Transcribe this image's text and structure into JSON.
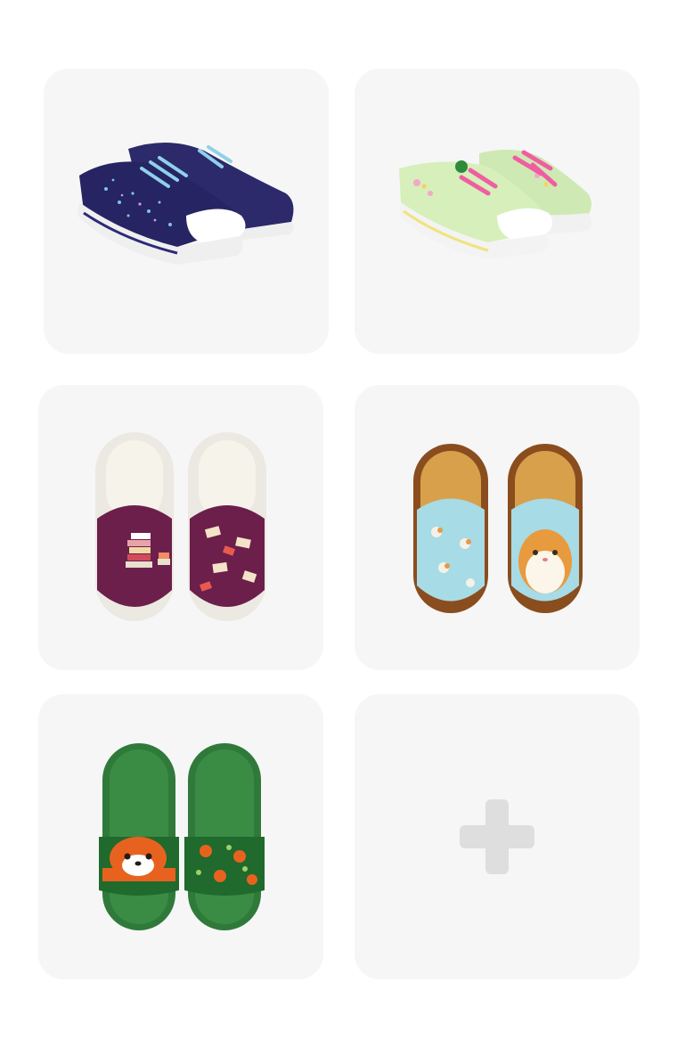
{
  "grid": {
    "items": [
      {
        "kind": "product",
        "icon": "sneakers-galaxy-image"
      },
      {
        "kind": "product",
        "icon": "sneakers-floral-image"
      },
      {
        "kind": "product",
        "icon": "slippers-books-image"
      },
      {
        "kind": "product",
        "icon": "slippers-hamster-image"
      },
      {
        "kind": "product",
        "icon": "slides-red-panda-image"
      },
      {
        "kind": "add",
        "icon": "plus-icon"
      }
    ]
  },
  "colors": {
    "card_background": "#f6f6f6",
    "plus": "#dedede",
    "page_background": "#ffffff"
  }
}
